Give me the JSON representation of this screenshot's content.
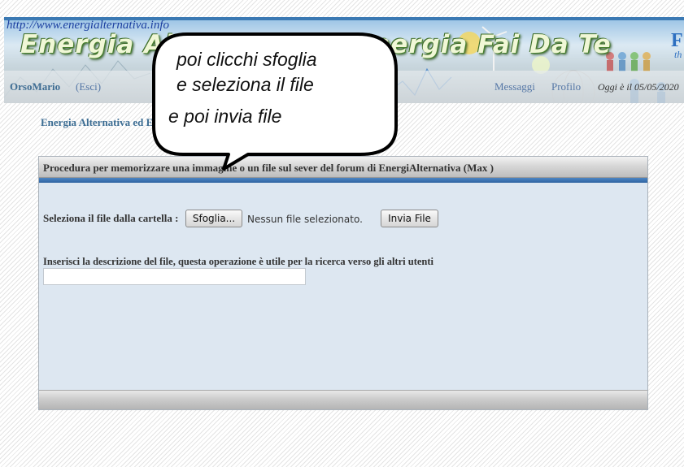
{
  "header": {
    "site_url": "http://www.energialternativa.info",
    "site_title": "Energia Alternativa & Energia Fai Da Te",
    "user_name": "OrsoMario",
    "logout_label": "(Esci)",
    "messages_label": "Messaggi",
    "profile_label": "Profilo",
    "date_text": "Oggi è il 05/05/2020"
  },
  "breadcrumb": "Energia Alternativa ed Energia Fai Da Te > UploadFile",
  "panel": {
    "title": "Procedura per memorizzare una immagine o un file sul sever del forum di EnergiAlternativa (Max )",
    "select_label": "Seleziona il file dalla cartella :",
    "browse_button_label": "Sfoglia...",
    "file_status": "Nessun file selezionato.",
    "upload_button_label": "Invia File",
    "description_label": "Inserisci la descrizione del file, questa operazione è utile per la ricerca verso gli altri utenti",
    "description_value": ""
  },
  "callout": {
    "line1": "poi clicchi sfoglia",
    "line2": "e seleziona il file",
    "line3": "e poi invia file"
  },
  "colors": {
    "accent_blue": "#2f63a1",
    "panel_bg": "#dde7f1",
    "link_blue": "#3c6d93"
  }
}
